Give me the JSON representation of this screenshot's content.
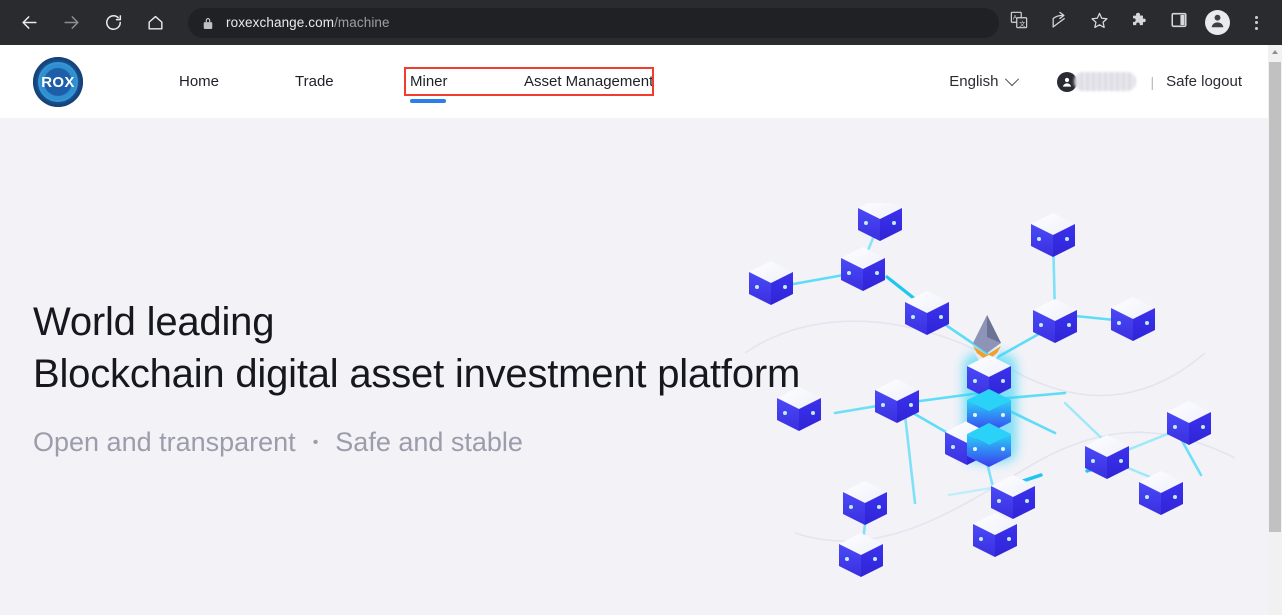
{
  "browser": {
    "back_icon": "back-arrow-icon",
    "forward_icon": "forward-arrow-icon",
    "reload_icon": "reload-icon",
    "home_icon": "home-icon",
    "lock_icon": "lock-icon",
    "url_domain": "roxexchange.com",
    "url_path": "/machine",
    "translate_icon": "translate-icon",
    "share_icon": "share-icon",
    "bookmark_icon": "star-icon",
    "extensions_icon": "puzzle-icon",
    "sidepanel_icon": "side-panel-icon",
    "profile_icon": "profile-avatar-icon",
    "menu_icon": "three-dot-menu-icon"
  },
  "site": {
    "logo_text": "ROX",
    "nav": [
      {
        "label": "Home",
        "active": false
      },
      {
        "label": "Trade",
        "active": false
      },
      {
        "label": "Miner",
        "active": true
      },
      {
        "label": "Asset Management",
        "active": false
      }
    ],
    "language": "English",
    "language_chevron": "chevron-down-icon",
    "user_icon": "user-account-icon",
    "username_redacted": "",
    "separator": "|",
    "logout": "Safe logout"
  },
  "hero": {
    "headline_line1": "World leading",
    "headline_line2": "Blockchain digital asset investment platform",
    "subtitle_left": "Open and transparent",
    "subtitle_bullet": "•",
    "subtitle_right": "Safe and stable",
    "illustration": "blockchain-network-illustration"
  },
  "annotation": {
    "box_color": "#f33b2e",
    "target": "Miner / Asset Management nav group"
  },
  "colors": {
    "browser_bar": "#292b2f",
    "omnibox": "#1f2125",
    "header_bg": "#ffffff",
    "hero_bg": "#f2f2f7",
    "accent_blue": "#2b7de9",
    "cube_blue": "#3b3bf0",
    "link_cyan": "#46d6f5",
    "headline": "#17171f",
    "subtitle": "#9c9cab"
  }
}
